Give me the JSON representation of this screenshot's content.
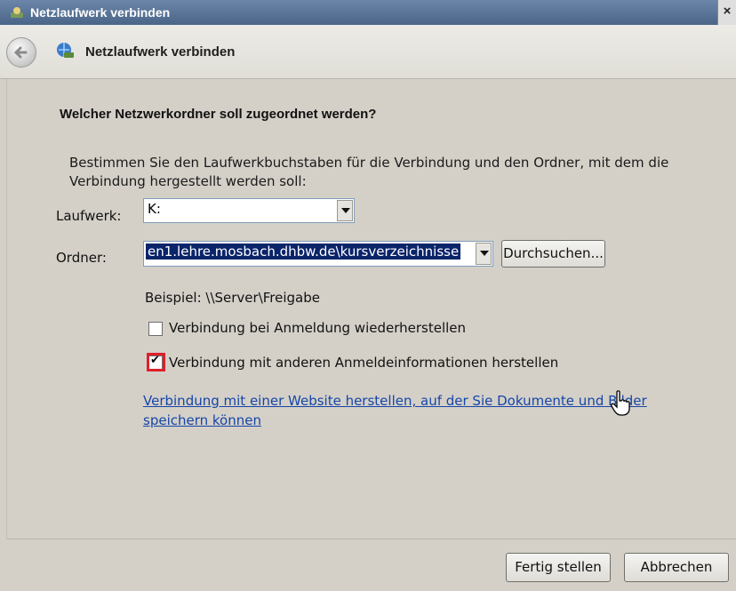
{
  "window": {
    "title": "Netzlaufwerk verbinden",
    "close_glyph": "×"
  },
  "nav": {
    "heading": "Netzlaufwerk verbinden"
  },
  "form": {
    "question": "Welcher Netzwerkordner soll zugeordnet werden?",
    "instruction": "Bestimmen Sie den Laufwerkbuchstaben für die Verbindung und den Ordner, mit dem die Verbindung hergestellt werden soll:",
    "drive_label": "Laufwerk:",
    "drive_value": "K:",
    "folder_label": "Ordner:",
    "folder_value": "en1.lehre.mosbach.dhbw.de\\kursverzeichnisse",
    "browse_label": "Durchsuchen...",
    "example": "Beispiel: \\\\Server\\Freigabe",
    "reconnect_label": "Verbindung bei Anmeldung wiederherstellen",
    "reconnect_checked": false,
    "other_creds_label": "Verbindung mit anderen Anmeldeinformationen herstellen",
    "other_creds_checked": true,
    "website_link": "Verbindung mit einer Website herstellen, auf der Sie Dokumente und Bilder speichern können"
  },
  "footer": {
    "finish_label": "Fertig stellen",
    "cancel_label": "Abbrechen"
  },
  "colors": {
    "titlebar": "#4a6588",
    "link": "#1646a8",
    "highlight_box": "#e01e2a",
    "selection": "#0a246a"
  },
  "icons": [
    "network-drive-icon",
    "back-arrow-icon",
    "dropdown-arrow-icon",
    "hand-cursor-icon",
    "close-icon"
  ]
}
